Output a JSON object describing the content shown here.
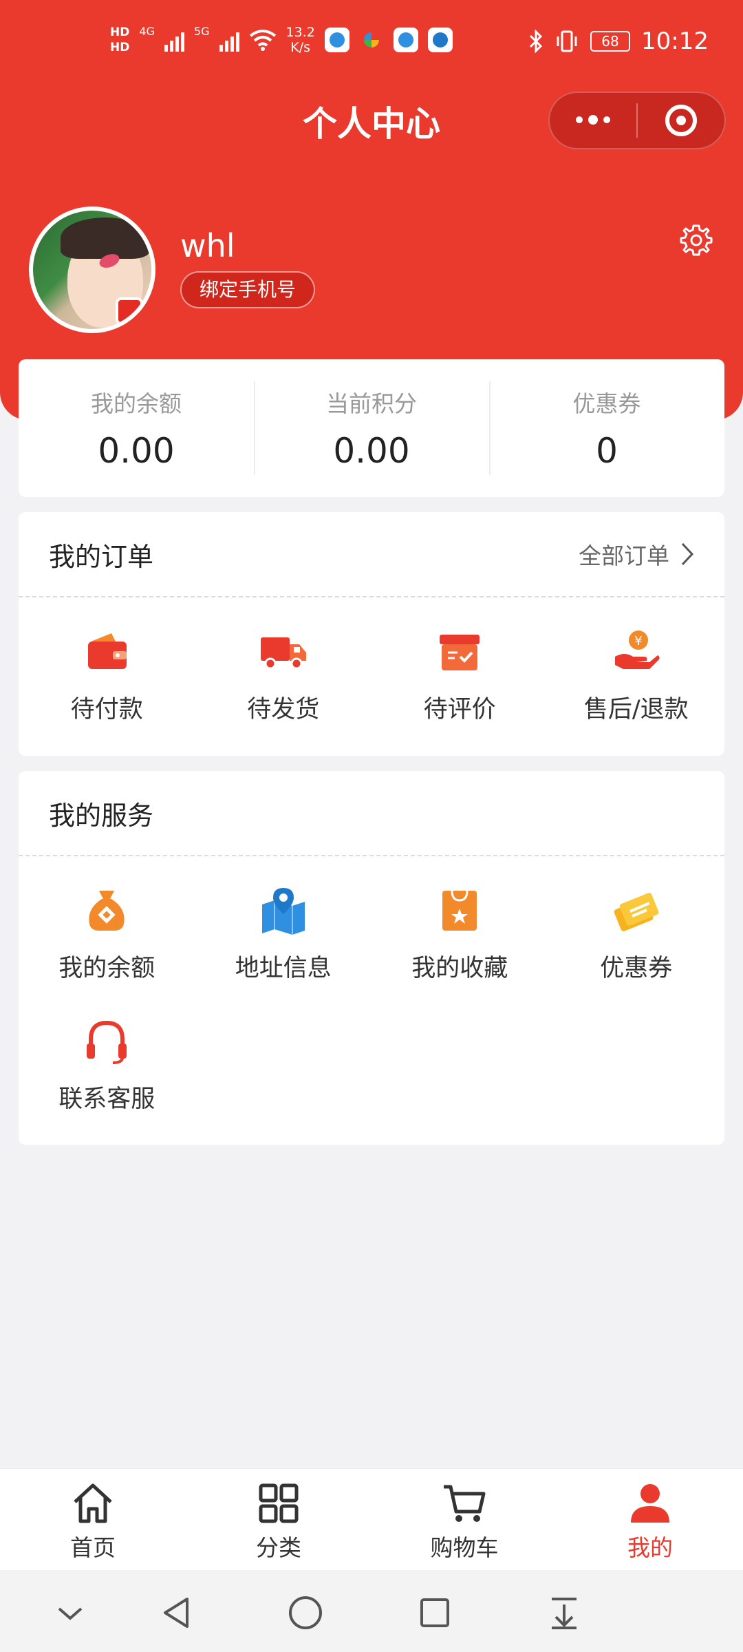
{
  "status_bar": {
    "hd1": "HD",
    "hd2": "HD",
    "net1": "4G",
    "net2": "5G",
    "speed_value": "13.2",
    "speed_unit": "K/s",
    "battery": "68",
    "time": "10:12"
  },
  "header": {
    "title": "个人中心"
  },
  "profile": {
    "username": "whl",
    "bind_phone": "绑定手机号"
  },
  "stats": [
    {
      "label": "我的余额",
      "value": "0.00"
    },
    {
      "label": "当前积分",
      "value": "0.00"
    },
    {
      "label": "优惠券",
      "value": "0"
    }
  ],
  "orders": {
    "title": "我的订单",
    "all_label": "全部订单",
    "items": [
      {
        "label": "待付款",
        "icon": "wallet-icon"
      },
      {
        "label": "待发货",
        "icon": "truck-icon"
      },
      {
        "label": "待评价",
        "icon": "review-box-icon"
      },
      {
        "label": "售后/退款",
        "icon": "refund-hand-icon"
      }
    ]
  },
  "services": {
    "title": "我的服务",
    "items": [
      {
        "label": "我的余额",
        "icon": "money-bag-icon"
      },
      {
        "label": "地址信息",
        "icon": "map-pin-icon"
      },
      {
        "label": "我的收藏",
        "icon": "favorite-bag-icon"
      },
      {
        "label": "优惠券",
        "icon": "coupon-icon"
      },
      {
        "label": "联系客服",
        "icon": "headset-icon"
      }
    ]
  },
  "tabbar": {
    "items": [
      {
        "label": "首页",
        "icon": "home-icon"
      },
      {
        "label": "分类",
        "icon": "grid-icon"
      },
      {
        "label": "购物车",
        "icon": "cart-icon"
      },
      {
        "label": "我的",
        "icon": "user-icon"
      }
    ],
    "active_index": 3
  },
  "colors": {
    "brand_red": "#e93a2d",
    "orange": "#f28a2b",
    "blue": "#2f8fe0",
    "yellow": "#f7b21f",
    "page_bg": "#f2f2f4"
  }
}
